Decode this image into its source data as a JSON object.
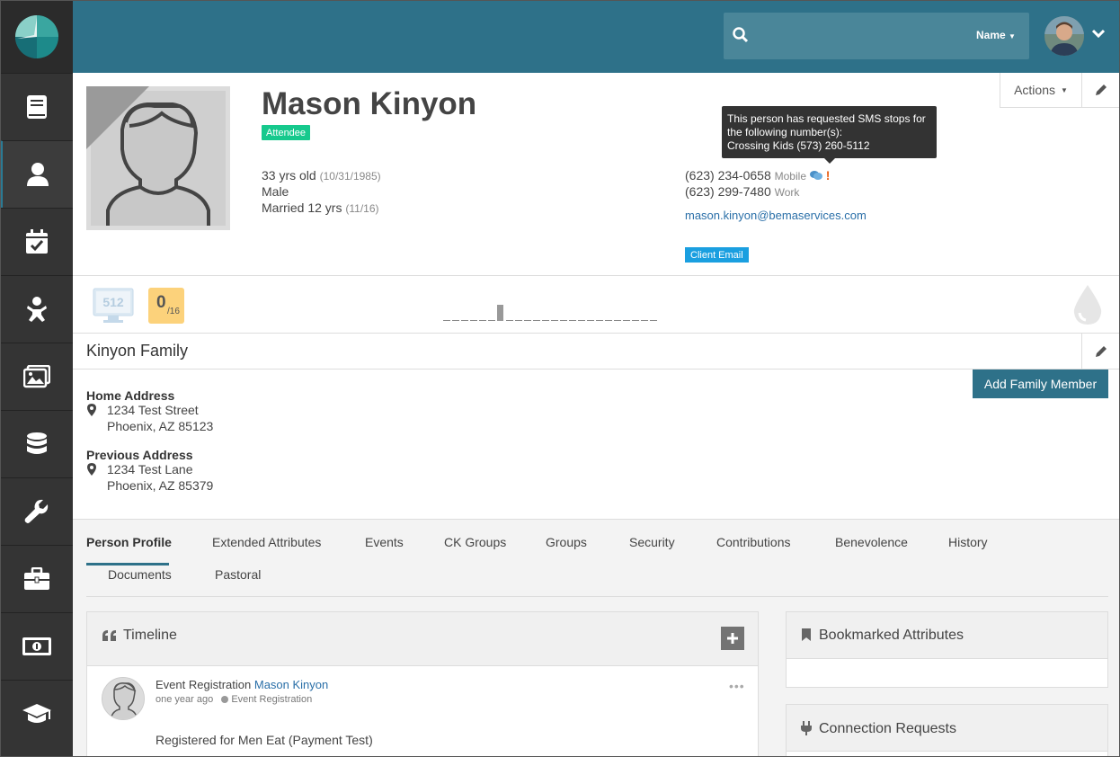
{
  "header": {
    "search_placeholder": "",
    "search_type": "Name"
  },
  "sidebar": {
    "items": [
      {
        "icon": "book-icon"
      },
      {
        "icon": "user-icon",
        "active": true
      },
      {
        "icon": "calendar-check-icon"
      },
      {
        "icon": "child-icon"
      },
      {
        "icon": "images-icon"
      },
      {
        "icon": "database-icon"
      },
      {
        "icon": "wrench-icon"
      },
      {
        "icon": "briefcase-icon"
      },
      {
        "icon": "money-icon"
      },
      {
        "icon": "graduation-cap-icon"
      }
    ]
  },
  "person": {
    "name": "Mason Kinyon",
    "status_badge": "Attendee",
    "age": "33 yrs old",
    "birthdate": "(10/31/1985)",
    "gender": "Male",
    "marital": "Married 12 yrs",
    "anniversary": "(11/16)",
    "phones": [
      {
        "number": "(623) 234-0658",
        "type": "Mobile"
      },
      {
        "number": "(623) 299-7480",
        "type": "Work"
      }
    ],
    "email": "mason.kinyon@bemaservices.com",
    "email_badge": "Client Email"
  },
  "tooltip": {
    "line1": "This person has requested SMS stops for",
    "line2": "the following number(s):",
    "line3": "Crossing Kids (573) 260-5112"
  },
  "toolbar": {
    "actions_label": "Actions"
  },
  "badges": {
    "screen_label": "512",
    "count": "0",
    "total": "/16"
  },
  "family": {
    "title": "Kinyon Family",
    "add_member_label": "Add Family Member",
    "addresses": [
      {
        "label": "Home Address",
        "line1": "1234 Test Street",
        "line2": "Phoenix, AZ 85123"
      },
      {
        "label": "Previous Address",
        "line1": "1234 Test Lane",
        "line2": "Phoenix, AZ 85379"
      }
    ]
  },
  "tabs": [
    "Person Profile",
    "Extended Attributes",
    "Events",
    "CK Groups",
    "Groups",
    "Security",
    "Contributions",
    "Benevolence",
    "History",
    "Documents",
    "Pastoral"
  ],
  "timeline": {
    "title": "Timeline",
    "entry": {
      "type": "Event Registration",
      "person": "Mason Kinyon",
      "when": "one year ago",
      "category": "Event Registration",
      "text": "Registered for Men Eat (Payment Test)"
    }
  },
  "right_panels": {
    "bookmarked": "Bookmarked Attributes",
    "connections": "Connection Requests"
  },
  "colors": {
    "header": "#2e7189",
    "sidebar": "#343434",
    "accent": "#2e7189",
    "attendee_badge": "#16c98d",
    "email_badge": "#1a9fe0"
  }
}
